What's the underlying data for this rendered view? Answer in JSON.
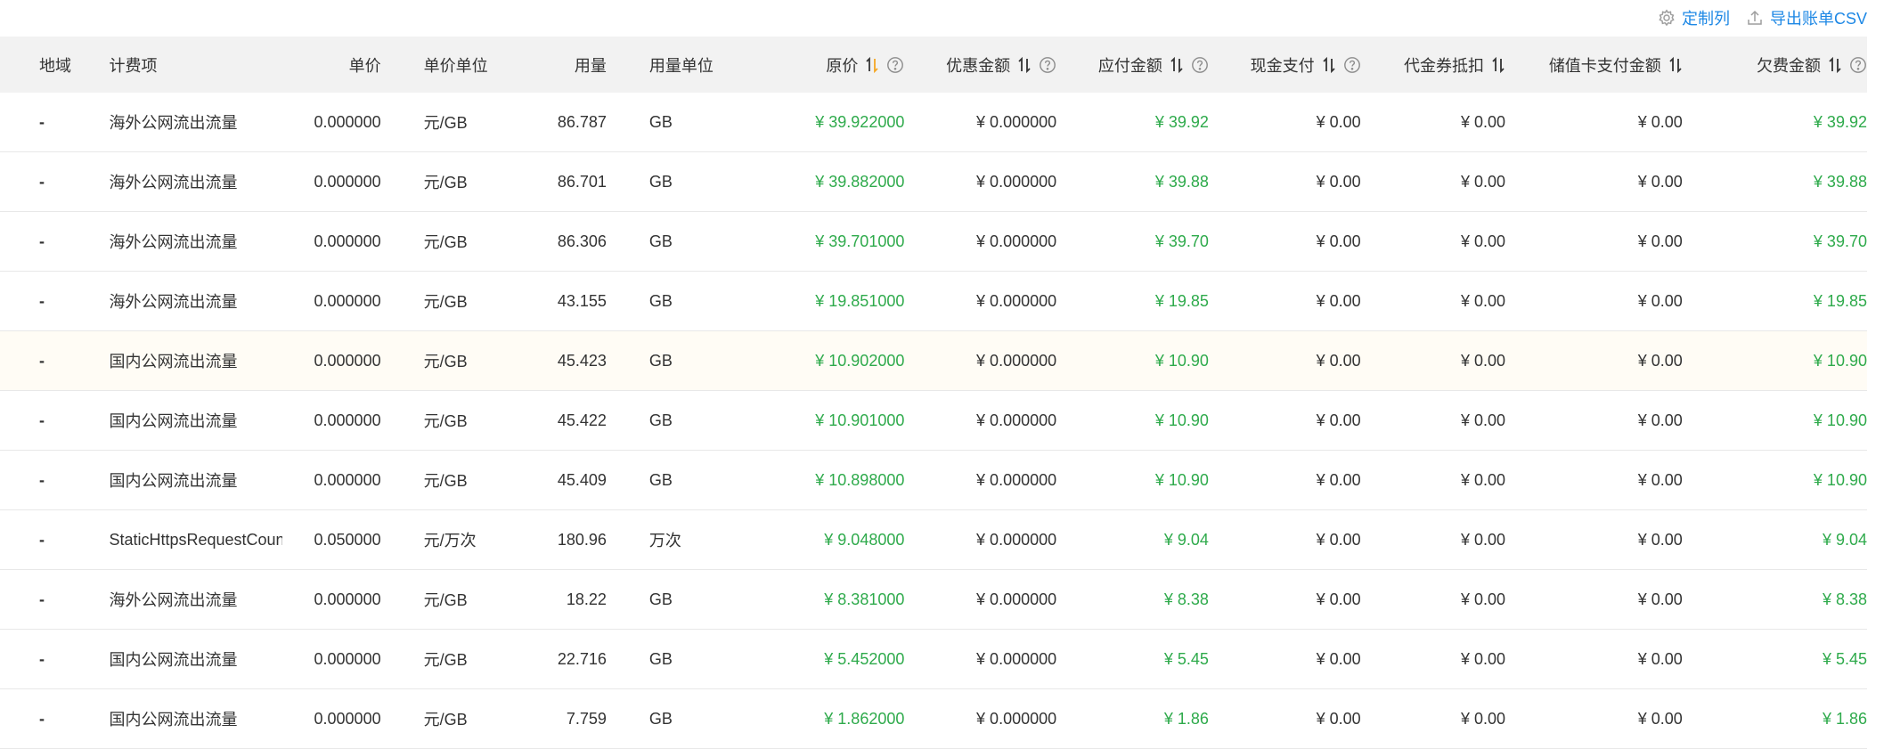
{
  "toolbar": {
    "customize_label": "定制列",
    "export_label": "导出账单CSV"
  },
  "columns": [
    {
      "label": "地域",
      "sort": false,
      "help": false
    },
    {
      "label": "计费项",
      "sort": false,
      "help": false
    },
    {
      "label": "单价",
      "sort": false,
      "help": false
    },
    {
      "label": "单价单位",
      "sort": false,
      "help": false
    },
    {
      "label": "用量",
      "sort": false,
      "help": false
    },
    {
      "label": "用量单位",
      "sort": false,
      "help": false
    },
    {
      "label": "原价",
      "sort": true,
      "sort_active": true,
      "help": true
    },
    {
      "label": "优惠金额",
      "sort": true,
      "sort_active": false,
      "help": true
    },
    {
      "label": "应付金额",
      "sort": true,
      "sort_active": false,
      "help": true
    },
    {
      "label": "现金支付",
      "sort": true,
      "sort_active": false,
      "help": true
    },
    {
      "label": "代金券抵扣",
      "sort": true,
      "sort_active": false,
      "help": false
    },
    {
      "label": "储值卡支付金额",
      "sort": true,
      "sort_active": false,
      "help": false
    },
    {
      "label": "欠费金额",
      "sort": true,
      "sort_active": false,
      "help": true
    }
  ],
  "rows": [
    [
      "-",
      "海外公网流出流量",
      "0.000000",
      "元/GB",
      "86.787",
      "GB",
      "¥ 39.922000",
      "¥ 0.000000",
      "¥ 39.92",
      "¥ 0.00",
      "¥ 0.00",
      "¥ 0.00",
      "¥ 39.92"
    ],
    [
      "-",
      "海外公网流出流量",
      "0.000000",
      "元/GB",
      "86.701",
      "GB",
      "¥ 39.882000",
      "¥ 0.000000",
      "¥ 39.88",
      "¥ 0.00",
      "¥ 0.00",
      "¥ 0.00",
      "¥ 39.88"
    ],
    [
      "-",
      "海外公网流出流量",
      "0.000000",
      "元/GB",
      "86.306",
      "GB",
      "¥ 39.701000",
      "¥ 0.000000",
      "¥ 39.70",
      "¥ 0.00",
      "¥ 0.00",
      "¥ 0.00",
      "¥ 39.70"
    ],
    [
      "-",
      "海外公网流出流量",
      "0.000000",
      "元/GB",
      "43.155",
      "GB",
      "¥ 19.851000",
      "¥ 0.000000",
      "¥ 19.85",
      "¥ 0.00",
      "¥ 0.00",
      "¥ 0.00",
      "¥ 19.85"
    ],
    [
      "-",
      "国内公网流出流量",
      "0.000000",
      "元/GB",
      "45.423",
      "GB",
      "¥ 10.902000",
      "¥ 0.000000",
      "¥ 10.90",
      "¥ 0.00",
      "¥ 0.00",
      "¥ 0.00",
      "¥ 10.90"
    ],
    [
      "-",
      "国内公网流出流量",
      "0.000000",
      "元/GB",
      "45.422",
      "GB",
      "¥ 10.901000",
      "¥ 0.000000",
      "¥ 10.90",
      "¥ 0.00",
      "¥ 0.00",
      "¥ 0.00",
      "¥ 10.90"
    ],
    [
      "-",
      "国内公网流出流量",
      "0.000000",
      "元/GB",
      "45.409",
      "GB",
      "¥ 10.898000",
      "¥ 0.000000",
      "¥ 10.90",
      "¥ 0.00",
      "¥ 0.00",
      "¥ 0.00",
      "¥ 10.90"
    ],
    [
      "-",
      "StaticHttpsRequestCount",
      "0.050000",
      "元/万次",
      "180.96",
      "万次",
      "¥ 9.048000",
      "¥ 0.000000",
      "¥ 9.04",
      "¥ 0.00",
      "¥ 0.00",
      "¥ 0.00",
      "¥ 9.04"
    ],
    [
      "-",
      "海外公网流出流量",
      "0.000000",
      "元/GB",
      "18.22",
      "GB",
      "¥ 8.381000",
      "¥ 0.000000",
      "¥ 8.38",
      "¥ 0.00",
      "¥ 0.00",
      "¥ 0.00",
      "¥ 8.38"
    ],
    [
      "-",
      "国内公网流出流量",
      "0.000000",
      "元/GB",
      "22.716",
      "GB",
      "¥ 5.452000",
      "¥ 0.000000",
      "¥ 5.45",
      "¥ 0.00",
      "¥ 0.00",
      "¥ 0.00",
      "¥ 5.45"
    ],
    [
      "-",
      "国内公网流出流量",
      "0.000000",
      "元/GB",
      "7.759",
      "GB",
      "¥ 1.862000",
      "¥ 0.000000",
      "¥ 1.86",
      "¥ 0.00",
      "¥ 0.00",
      "¥ 0.00",
      "¥ 1.86"
    ]
  ],
  "highlighted_row": 4,
  "colors": {
    "accent_blue": "#1e88e5",
    "amount_green": "#2eaa4b",
    "sort_active_orange": "#f5a623",
    "header_bg": "#f2f2f2",
    "row_highlight": "#fffcf5"
  },
  "icons": {
    "customize": "gear-icon",
    "export": "upload-icon",
    "sort": "sort-icon",
    "help": "help-icon"
  }
}
